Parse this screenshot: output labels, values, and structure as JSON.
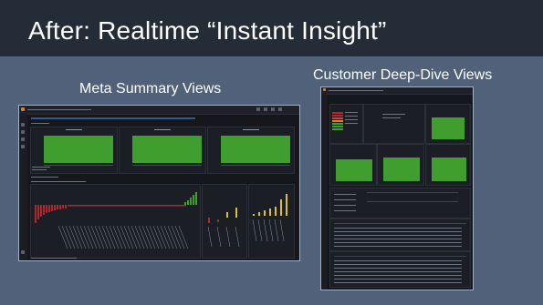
{
  "slide": {
    "title": "After: Realtime “Instant Insight”",
    "left_caption": "Meta Summary Views",
    "right_caption": "Customer Deep-Dive Views"
  },
  "screenshots": {
    "left": {
      "description_hidden": "",
      "accent": "#3f9e2e",
      "bar_red": "#b0262c",
      "bar_yellow": "#d9c23a"
    },
    "right": {
      "accent": "#3f9e2e"
    }
  }
}
